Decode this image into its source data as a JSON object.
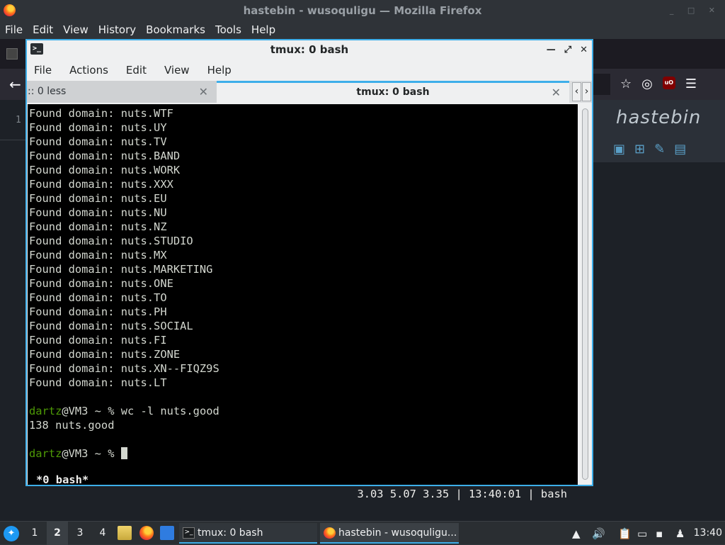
{
  "firefox": {
    "title": "hastebin - wusoquligu — Mozilla Firefox",
    "menu": [
      "File",
      "Edit",
      "View",
      "History",
      "Bookmarks",
      "Tools",
      "Help"
    ],
    "gutter_line": "1",
    "hastebin_logo": "hastebin"
  },
  "konsole": {
    "title": "tmux: 0 bash",
    "menu": [
      "File",
      "Actions",
      "Edit",
      "View",
      "Help"
    ],
    "tabs": [
      {
        "label": ":: 0 less"
      },
      {
        "label": "tmux: 0 bash"
      }
    ],
    "terminal": {
      "lines": [
        "Found domain: nuts.WTF",
        "Found domain: nuts.UY",
        "Found domain: nuts.TV",
        "Found domain: nuts.BAND",
        "Found domain: nuts.WORK",
        "Found domain: nuts.XXX",
        "Found domain: nuts.EU",
        "Found domain: nuts.NU",
        "Found domain: nuts.NZ",
        "Found domain: nuts.STUDIO",
        "Found domain: nuts.MX",
        "Found domain: nuts.MARKETING",
        "Found domain: nuts.ONE",
        "Found domain: nuts.TO",
        "Found domain: nuts.PH",
        "Found domain: nuts.SOCIAL",
        "Found domain: nuts.FI",
        "Found domain: nuts.ZONE",
        "Found domain: nuts.XN--FIQZ9S",
        "Found domain: nuts.LT"
      ],
      "prompt_user": "dartz",
      "prompt_rest": "@VM3 ~ % ",
      "command": "wc -l nuts.good",
      "output": "138 nuts.good",
      "status_left": "*0 bash*",
      "status_right": "3.03 5.07 3.35 | 13:40:01 | bash"
    }
  },
  "taskbar": {
    "desktops": [
      "1",
      "2",
      "3",
      "4"
    ],
    "active_desktop": "2",
    "tasks": [
      "tmux: 0 bash",
      "hastebin - wusoquligu..."
    ],
    "clock": "13:40"
  },
  "colors": {
    "accent": "#3daee9",
    "prompt_green": "#4e9a06",
    "terminal_bg": "#000000",
    "hastebin_icon": "#5a9fc7"
  }
}
